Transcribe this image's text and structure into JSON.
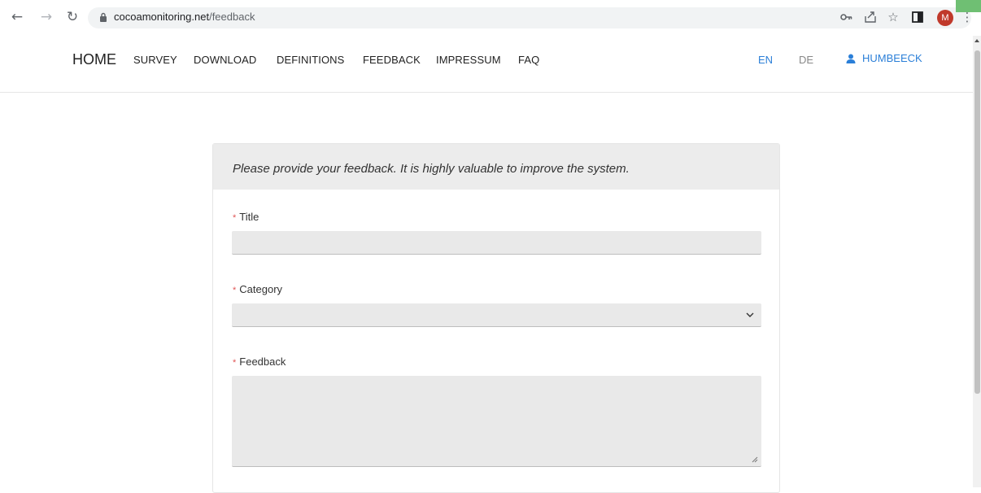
{
  "browser": {
    "url_host": "cocoamonitoring.net",
    "url_path": "/feedback",
    "avatar_initial": "M"
  },
  "nav": {
    "home": "HOME",
    "items": [
      "SURVEY",
      "DOWNLOAD",
      "DEFINITIONS",
      "FEEDBACK",
      "IMPRESSUM",
      "FAQ"
    ],
    "lang_en": "EN",
    "lang_de": "DE",
    "user": "HUMBEECK"
  },
  "form": {
    "intro": "Please provide your feedback. It is highly valuable to improve the system.",
    "required_mark": "*",
    "title_label": "Title",
    "title_value": "",
    "category_label": "Category",
    "category_value": "",
    "feedback_label": "Feedback",
    "feedback_value": ""
  },
  "colors": {
    "accent": "#2b7fd8",
    "required": "#e05555",
    "field_bg": "#e9e9e9",
    "header_bg": "#ececec"
  }
}
